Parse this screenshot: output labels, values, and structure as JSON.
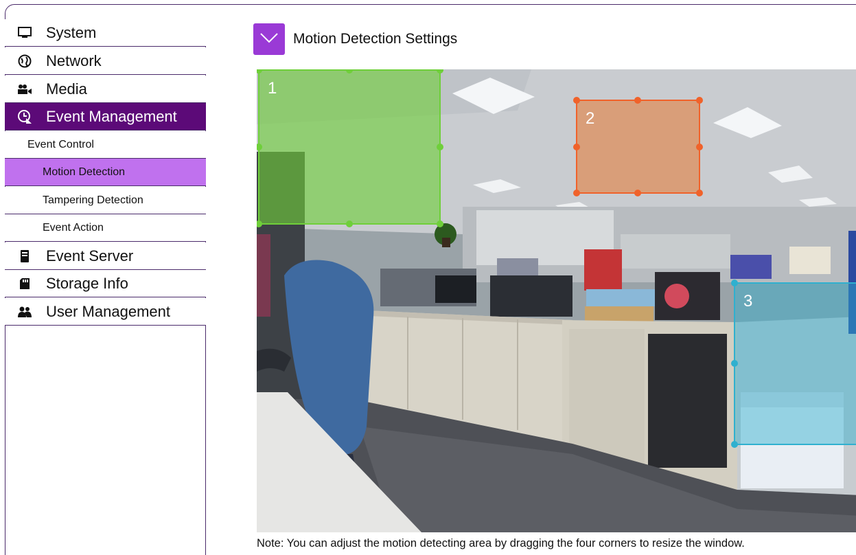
{
  "sidebar": {
    "items": [
      {
        "label": "System",
        "icon": "monitor-icon"
      },
      {
        "label": "Network",
        "icon": "globe-icon"
      },
      {
        "label": "Media",
        "icon": "camera-icon"
      },
      {
        "label": "Event Management",
        "icon": "event-icon"
      },
      {
        "label": "Event Server",
        "icon": "server-icon"
      },
      {
        "label": "Storage Info",
        "icon": "sd-card-icon"
      },
      {
        "label": "User Management",
        "icon": "users-icon"
      }
    ],
    "sub_items": [
      {
        "label": "Event Control"
      },
      {
        "label": "Motion Detection"
      },
      {
        "label": "Tampering Detection"
      },
      {
        "label": "Event Action"
      }
    ]
  },
  "main": {
    "title": "Motion Detection Settings",
    "zones": [
      {
        "label": "1",
        "color": "#6fcf3a"
      },
      {
        "label": "2",
        "color": "#f0622a"
      },
      {
        "label": "3",
        "color": "#2fb0cf"
      }
    ],
    "note": "Note: You can adjust the motion detecting area by dragging the four corners to resize the window."
  },
  "colors": {
    "accent": "#5c0a78",
    "selected": "#c071ee",
    "toggle": "#9a3ad6",
    "border": "#4a2a6a"
  }
}
